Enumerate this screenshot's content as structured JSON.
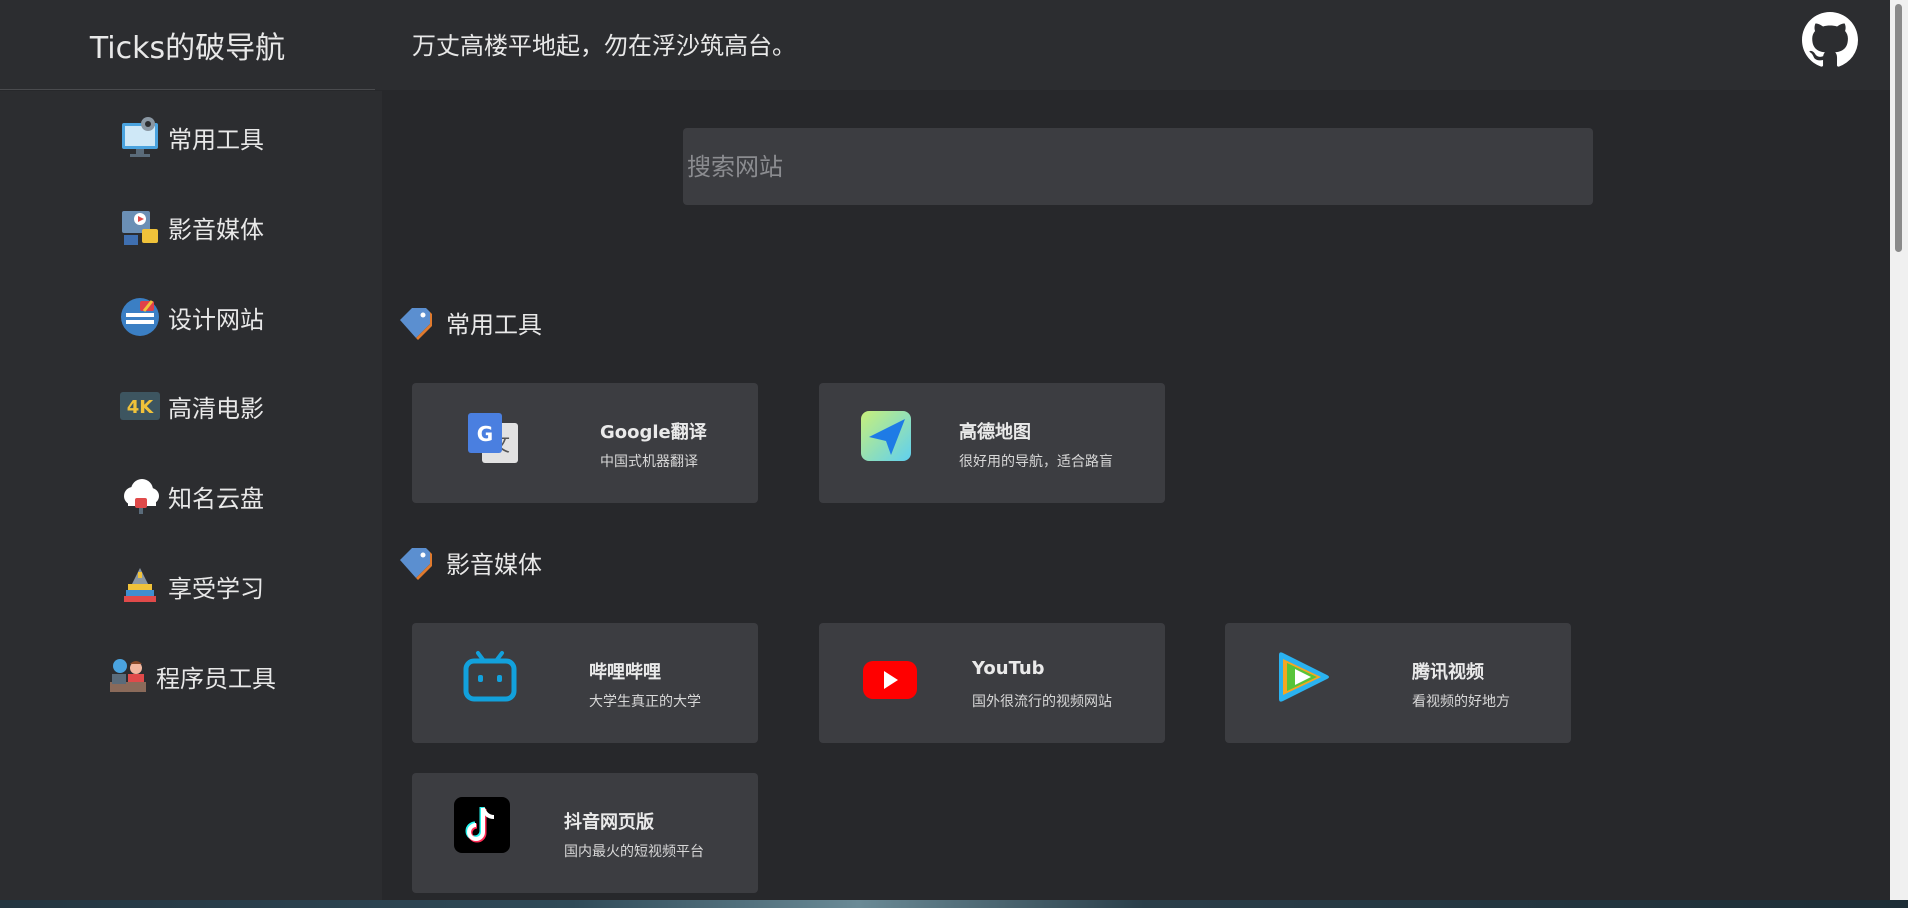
{
  "header": {
    "brand": "Ticks的破导航",
    "motto": "万丈高楼平地起，勿在浮沙筑高台。",
    "github_icon": "github-icon"
  },
  "sidebar": {
    "items": [
      {
        "label": "常用工具",
        "icon": "computer-settings-icon"
      },
      {
        "label": "影音媒体",
        "icon": "media-icon"
      },
      {
        "label": "设计网站",
        "icon": "design-icon"
      },
      {
        "label": "高清电影",
        "icon": "4k-icon"
      },
      {
        "label": "知名云盘",
        "icon": "cloud-drive-icon"
      },
      {
        "label": "享受学习",
        "icon": "study-icon"
      },
      {
        "label": "程序员工具",
        "icon": "programmer-icon"
      }
    ]
  },
  "search": {
    "placeholder": "搜索网站"
  },
  "sections": [
    {
      "title": "常用工具",
      "cards": [
        {
          "title": "Google翻译",
          "desc": "中国式机器翻译",
          "icon": "google-translate-icon"
        },
        {
          "title": "高德地图",
          "desc": "很好用的导航，适合路盲",
          "icon": "amap-icon"
        }
      ]
    },
    {
      "title": "影音媒体",
      "cards": [
        {
          "title": "哔哩哔哩",
          "desc": "大学生真正的大学",
          "icon": "bilibili-icon"
        },
        {
          "title": "YouTub",
          "desc": "国外很流行的视频网站",
          "icon": "youtube-icon"
        },
        {
          "title": "腾讯视频",
          "desc": "看视频的好地方",
          "icon": "tencent-video-icon"
        },
        {
          "title": "抖音网页版",
          "desc": "国内最火的短视频平台",
          "icon": "tiktok-icon"
        }
      ]
    }
  ],
  "colors": {
    "background": "#27282b",
    "panel": "#2c2d30",
    "card": "#3c3d41",
    "text": "#e8e8e8"
  }
}
